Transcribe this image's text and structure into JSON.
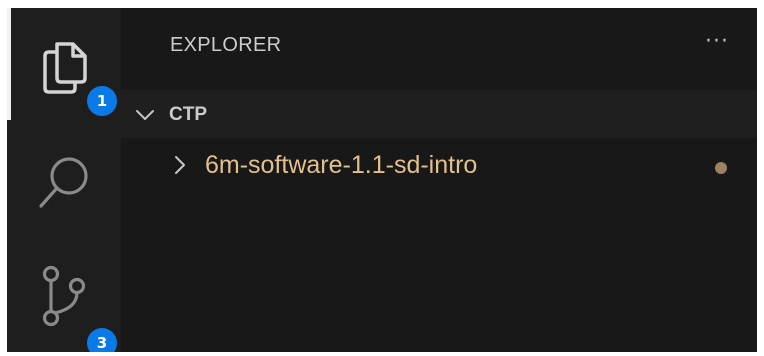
{
  "activity_bar": {
    "explorer": {
      "icon": "files-icon",
      "badge": "1",
      "active": true
    },
    "search": {
      "icon": "search-icon"
    },
    "source_control": {
      "icon": "source-control-icon",
      "badge": "3"
    }
  },
  "sidebar": {
    "title": "EXPLORER",
    "more_actions_label": "···",
    "section": {
      "title": "CTP",
      "expanded": true
    },
    "tree": [
      {
        "label": "6m-software-1.1-sd-intro",
        "type": "folder",
        "expanded": false,
        "modified": true
      }
    ]
  },
  "colors": {
    "activity_bar_bg": "#1e1e1e",
    "sidebar_bg": "#181818",
    "badge_bg": "#0a7ae6",
    "folder_modified_text": "#e2c08d",
    "modified_dot": "#9c8263"
  }
}
